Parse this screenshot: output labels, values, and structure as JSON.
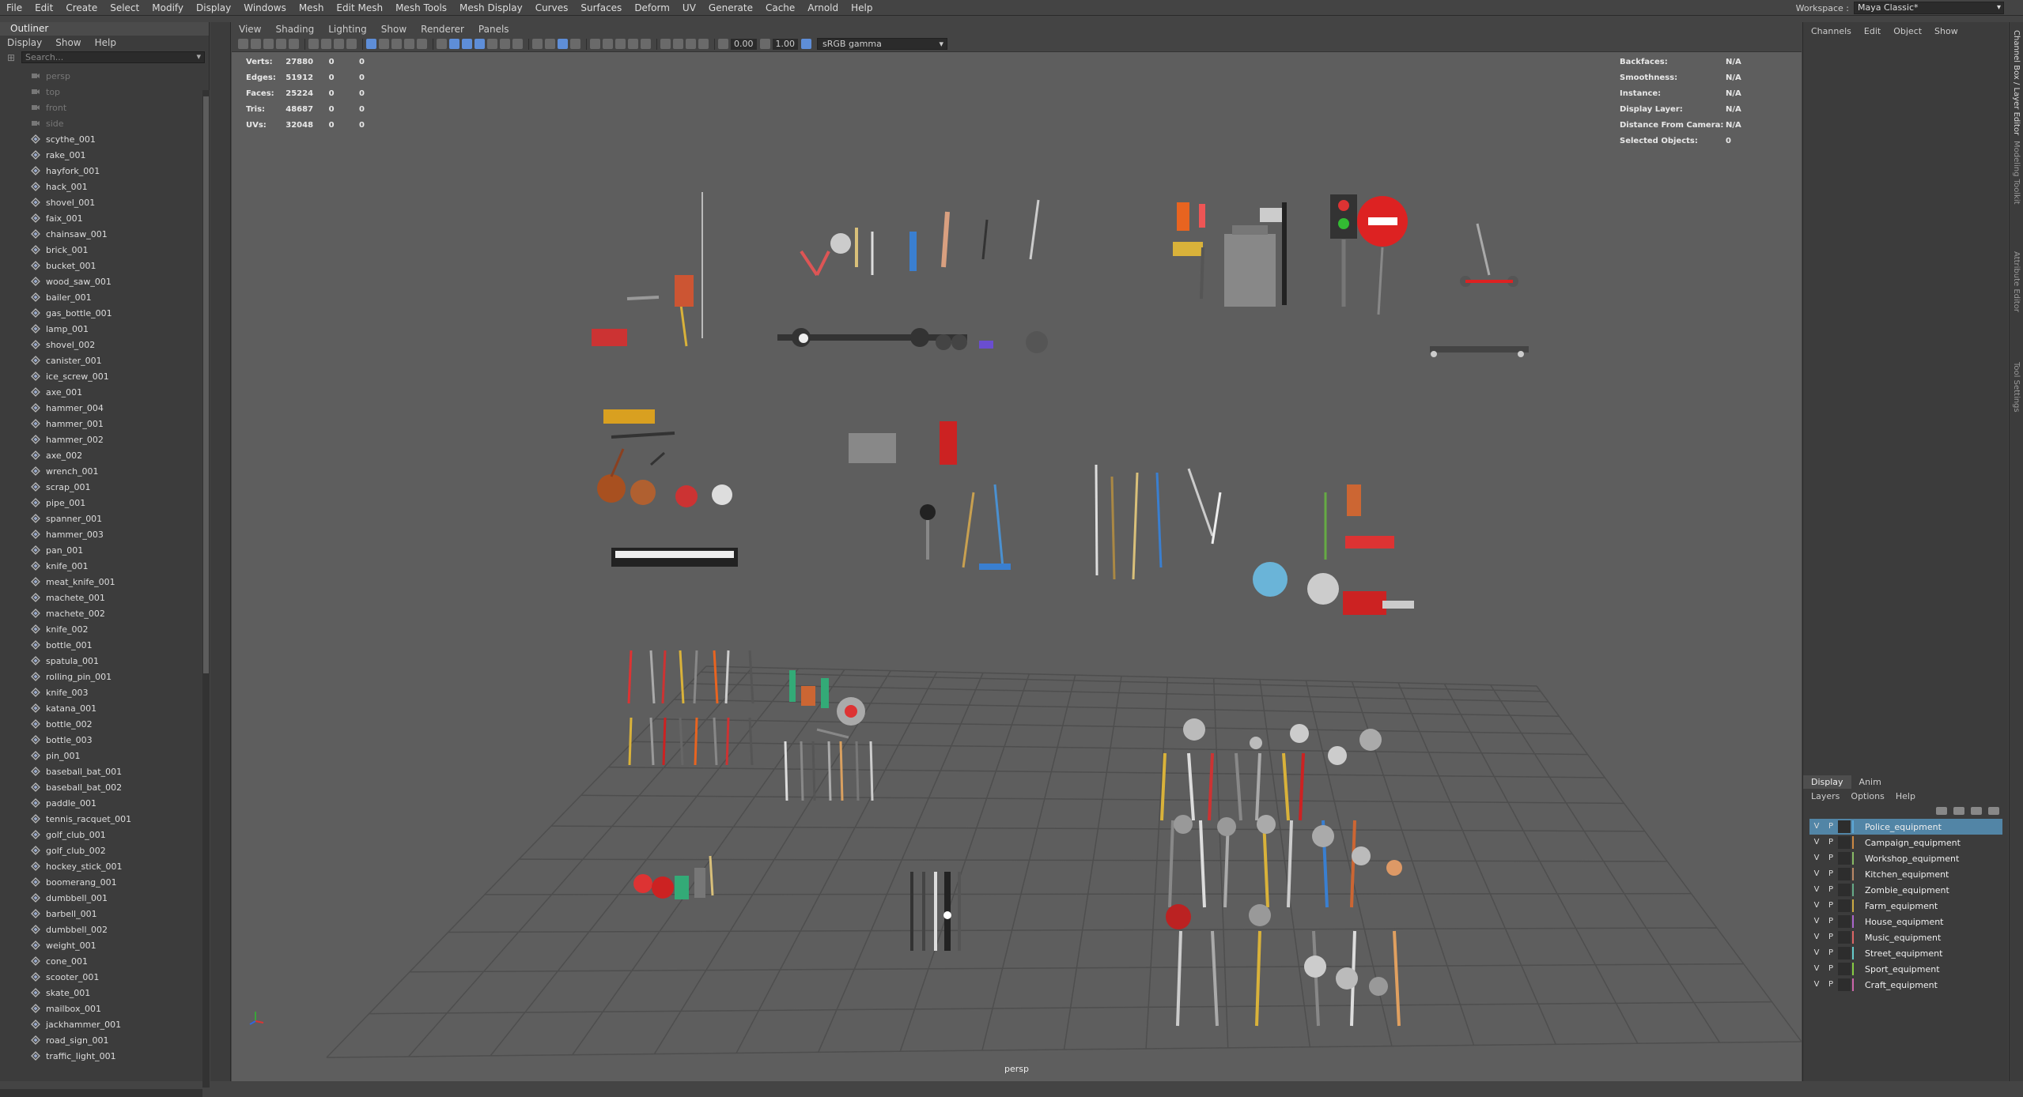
{
  "menubar": {
    "items": [
      "File",
      "Edit",
      "Create",
      "Select",
      "Modify",
      "Display",
      "Windows",
      "Mesh",
      "Edit Mesh",
      "Mesh Tools",
      "Mesh Display",
      "Curves",
      "Surfaces",
      "Deform",
      "UV",
      "Generate",
      "Cache",
      "Arnold",
      "Help"
    ],
    "workspace_label": "Workspace :",
    "workspace_value": "Maya Classic*"
  },
  "outliner": {
    "title": "Outliner",
    "menu": [
      "Display",
      "Show",
      "Help"
    ],
    "search_placeholder": "Search...",
    "cameras": [
      "persp",
      "top",
      "front",
      "side"
    ],
    "items": [
      "scythe_001",
      "rake_001",
      "hayfork_001",
      "hack_001",
      "shovel_001",
      "faix_001",
      "chainsaw_001",
      "brick_001",
      "bucket_001",
      "wood_saw_001",
      "bailer_001",
      "gas_bottle_001",
      "lamp_001",
      "shovel_002",
      "canister_001",
      "ice_screw_001",
      "axe_001",
      "hammer_004",
      "hammer_001",
      "hammer_002",
      "axe_002",
      "wrench_001",
      "scrap_001",
      "pipe_001",
      "spanner_001",
      "hammer_003",
      "pan_001",
      "knife_001",
      "meat_knife_001",
      "machete_001",
      "machete_002",
      "knife_002",
      "bottle_001",
      "spatula_001",
      "rolling_pin_001",
      "knife_003",
      "katana_001",
      "bottle_002",
      "bottle_003",
      "pin_001",
      "baseball_bat_001",
      "baseball_bat_002",
      "paddle_001",
      "tennis_racquet_001",
      "golf_club_001",
      "golf_club_002",
      "hockey_stick_001",
      "boomerang_001",
      "dumbbell_001",
      "barbell_001",
      "dumbbell_002",
      "weight_001",
      "cone_001",
      "scooter_001",
      "skate_001",
      "mailbox_001",
      "jackhammer_001",
      "road_sign_001",
      "traffic_light_001"
    ]
  },
  "viewport": {
    "menu": [
      "View",
      "Shading",
      "Lighting",
      "Show",
      "Renderer",
      "Panels"
    ],
    "exposure": "0.00",
    "gamma": "1.00",
    "color_space": "sRGB gamma",
    "camera_label": "persp",
    "stats": [
      {
        "label": "Verts:",
        "v1": "27880",
        "v2": "0",
        "v3": "0"
      },
      {
        "label": "Edges:",
        "v1": "51912",
        "v2": "0",
        "v3": "0"
      },
      {
        "label": "Faces:",
        "v1": "25224",
        "v2": "0",
        "v3": "0"
      },
      {
        "label": "Tris:",
        "v1": "48687",
        "v2": "0",
        "v3": "0"
      },
      {
        "label": "UVs:",
        "v1": "32048",
        "v2": "0",
        "v3": "0"
      }
    ],
    "info": [
      {
        "label": "Backfaces:",
        "value": "N/A"
      },
      {
        "label": "Smoothness:",
        "value": "N/A"
      },
      {
        "label": "Instance:",
        "value": "N/A"
      },
      {
        "label": "Display Layer:",
        "value": "N/A"
      },
      {
        "label": "Distance From Camera:",
        "value": "N/A"
      },
      {
        "label": "Selected Objects:",
        "value": "0"
      }
    ]
  },
  "channel_box": {
    "menu": [
      "Channels",
      "Edit",
      "Object",
      "Show"
    ]
  },
  "layer_editor": {
    "tabs": [
      "Display",
      "Anim"
    ],
    "menu": [
      "Layers",
      "Options",
      "Help"
    ],
    "v": "V",
    "p": "P",
    "layers": [
      "Police_equipment",
      "Campaign_equipment",
      "Workshop_equipment",
      "Kitchen_equipment",
      "Zombie_equipment",
      "Farm_equipment",
      "House_equipment",
      "Music_equipment",
      "Street_equipment",
      "Sport_equipment",
      "Craft_equipment"
    ]
  },
  "side_tabs": [
    "Channel Box / Layer Editor",
    "Modeling Toolkit",
    "Attribute Editor",
    "Tool Settings"
  ],
  "colors": {
    "accent": "#5285a6",
    "viewport_bg": "#5e5e5e",
    "panel_bg": "#3c3c3c"
  }
}
